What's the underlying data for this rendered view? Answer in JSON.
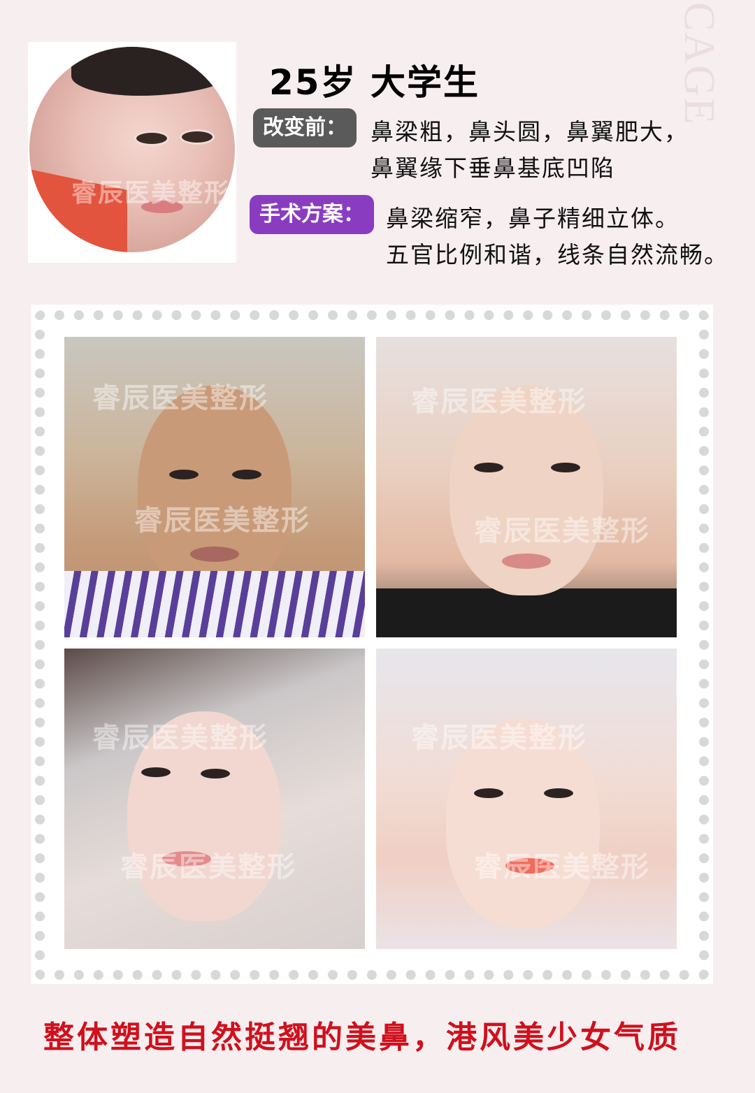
{
  "decor": {
    "side_letters": "CAGE"
  },
  "profile": {
    "title": "25岁 大学生",
    "before_label": "改变前：",
    "before_lines": [
      "鼻梁粗，鼻头圆，鼻翼肥大，",
      "鼻翼缘下垂鼻基底凹陷"
    ],
    "plan_label": "手术方案：",
    "plan_lines": [
      "鼻梁缩窄，鼻子精细立体。",
      "五官比例和谐，线条自然流畅。"
    ]
  },
  "watermark": "睿辰医美整形",
  "caption": "整体塑造自然挺翘的美鼻，港风美少女气质",
  "colors": {
    "before_badge": "#5a5a5a",
    "plan_badge": "#8a3cc1",
    "caption": "#d0101c"
  }
}
